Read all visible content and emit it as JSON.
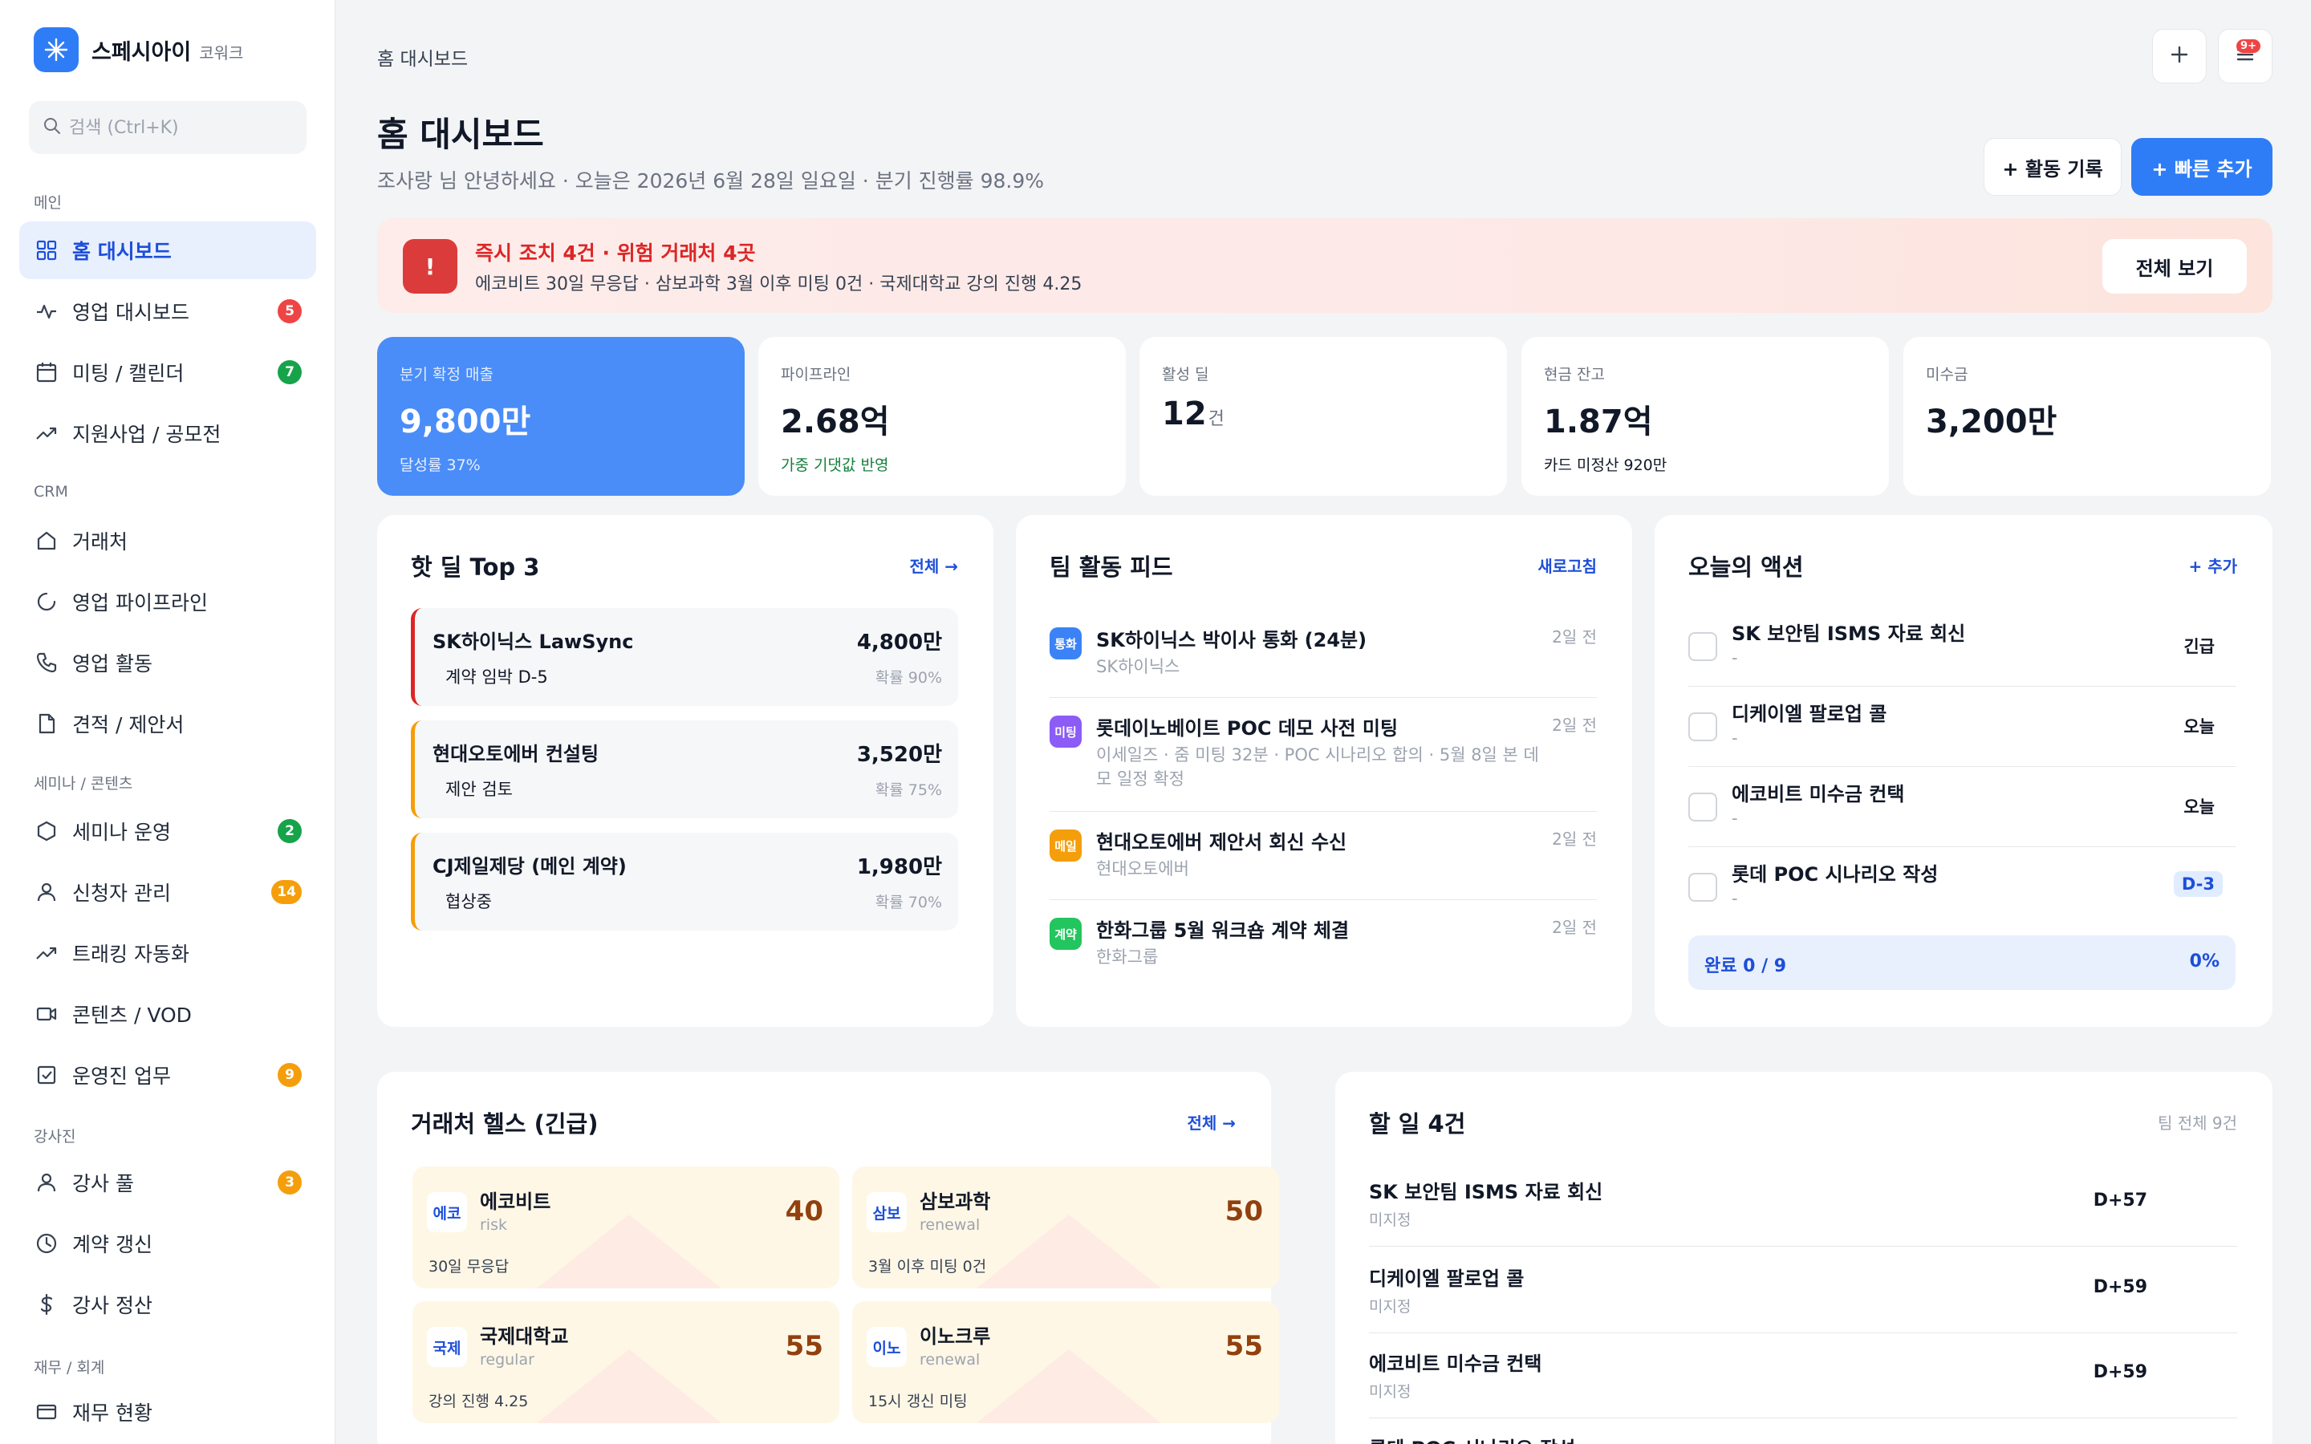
{
  "brand": {
    "name": "스페시아이",
    "sub": "코워크"
  },
  "search": {
    "placeholder": "검색 (Ctrl+K)"
  },
  "sidebar": {
    "sections": [
      "메인",
      "CRM",
      "세미나 / 콘텐츠",
      "강사진",
      "재무 / 회계"
    ],
    "items": [
      {
        "label": "홈 대시보드",
        "icon": "grid-icon",
        "active": true
      },
      {
        "label": "영업 대시보드",
        "icon": "activity-icon",
        "badge": "5",
        "badge_color": "#ef4444"
      },
      {
        "label": "미팅 / 캘린더",
        "icon": "calendar-icon",
        "badge": "7",
        "badge_color": "#16a34a"
      },
      {
        "label": "지원사업 / 공모전",
        "icon": "trending-up-icon"
      },
      {
        "label": "거래처",
        "icon": "home-icon"
      },
      {
        "label": "영업 파이프라인",
        "icon": "loader-icon"
      },
      {
        "label": "영업 활동",
        "icon": "phone-icon"
      },
      {
        "label": "견적 / 제안서",
        "icon": "file-icon"
      },
      {
        "label": "세미나 운영",
        "icon": "hexagon-icon",
        "badge": "2",
        "badge_color": "#16a34a"
      },
      {
        "label": "신청자 관리",
        "icon": "user-icon",
        "badge": "14",
        "badge_color": "#f59e0b"
      },
      {
        "label": "트래킹 자동화",
        "icon": "trending-up-icon"
      },
      {
        "label": "콘텐츠 / VOD",
        "icon": "video-icon"
      },
      {
        "label": "운영진 업무",
        "icon": "check-square-icon",
        "badge": "9",
        "badge_color": "#f59e0b"
      },
      {
        "label": "강사 풀",
        "icon": "user-icon",
        "badge": "3",
        "badge_color": "#f59e0b"
      },
      {
        "label": "계약 갱신",
        "icon": "clock-icon"
      },
      {
        "label": "강사 정산",
        "icon": "dollar-icon"
      },
      {
        "label": "재무 현황",
        "icon": "credit-card-icon"
      }
    ]
  },
  "header": {
    "breadcrumb": "홈 대시보드",
    "title": "홈 대시보드",
    "subtitle": "조사랑 님 안녕하세요 · 오늘은 2026년 6월 28일 일요일 · 분기 진행률 98.9%",
    "notif_badge": "9+",
    "log_activity": "+ 활동 기록",
    "quick_add": "+ 빠른 추가"
  },
  "alert": {
    "icon_text": "!",
    "title": "즉시 조치 4건 · 위험 거래처 4곳",
    "desc": "에코비트 30일 무응답 · 삼보과학 3월 이후 미팅 0건 · 국제대학교 강의 진행 4.25",
    "button": "전체 보기"
  },
  "kpis": [
    {
      "label": "분기 확정 매출",
      "value": "9,800만",
      "foot": "달성률 37%"
    },
    {
      "label": "파이프라인",
      "value": "2.68억",
      "foot": "가중 기댓값 반영"
    },
    {
      "label": "활성 딜",
      "value": "12",
      "unit": "건",
      "foot": ""
    },
    {
      "label": "현금 잔고",
      "value": "1.87억",
      "foot": "카드 미정산 920만"
    },
    {
      "label": "미수금",
      "value": "3,200만",
      "foot": ""
    }
  ],
  "hot_deals": {
    "title": "핫 딜 Top 3",
    "link": "전체 →",
    "items": [
      {
        "name": "SK하이닉스 LawSync",
        "stage": "계약 임박 D-5",
        "amount": "4,800만",
        "prob": "확률 90%",
        "color": "#dc2626"
      },
      {
        "name": "현대오토에버 컨설팅",
        "stage": "제안 검토",
        "amount": "3,520만",
        "prob": "확률 75%",
        "color": "#f59e0b"
      },
      {
        "name": "CJ제일제당 (메인 계약)",
        "stage": "협상중",
        "amount": "1,980만",
        "prob": "확률 70%",
        "color": "#f59e0b"
      }
    ]
  },
  "team_feed": {
    "title": "팀 활동 피드",
    "link": "새로고침",
    "items": [
      {
        "tag": "통화",
        "tag_color": "#3b82f6",
        "title": "SK하이닉스 박이사 통화 (24분)",
        "sub": "SK하이닉스",
        "time": "2일 전"
      },
      {
        "tag": "미팅",
        "tag_color": "#8b5cf6",
        "title": "롯데이노베이트 POC 데모 사전 미팅",
        "sub": "이세일즈 · 줌 미팅 32분 · POC 시나리오 합의 · 5월 8일 본 데모 일정 확정",
        "time": "2일 전"
      },
      {
        "tag": "메일",
        "tag_color": "#f59e0b",
        "title": "현대오토에버 제안서 회신 수신",
        "sub": "현대오토에버",
        "time": "2일 전"
      },
      {
        "tag": "계약",
        "tag_color": "#22c55e",
        "title": "한화그룹 5월 워크숍 계약 체결",
        "sub": "한화그룹",
        "time": "2일 전"
      }
    ]
  },
  "today_actions": {
    "title": "오늘의 액션",
    "link": "+ 추가",
    "items": [
      {
        "title": "SK 보안팀 ISMS 자료 회신",
        "sub": "-",
        "tag": "긴급"
      },
      {
        "title": "디케이엘 팔로업 콜",
        "sub": "-",
        "tag": "오늘"
      },
      {
        "title": "에코비트 미수금 컨택",
        "sub": "-",
        "tag": "오늘"
      },
      {
        "title": "롯데 POC 시나리오 작성",
        "sub": "-",
        "tag": "D-3",
        "highlight": true
      }
    ],
    "progress_label": "완료 0 / 9",
    "progress_pct": "0%",
    "progress_value": 0
  },
  "client_health": {
    "title": "거래처 헬스 (긴급)",
    "link": "전체 →",
    "items": [
      {
        "abbr": "에코",
        "name": "에코비트",
        "type": "risk",
        "score": "40",
        "note": "30일 무응답"
      },
      {
        "abbr": "삼보",
        "name": "삼보과학",
        "type": "renewal",
        "score": "50",
        "note": "3월 이후 미팅 0건"
      },
      {
        "abbr": "국제",
        "name": "국제대학교",
        "type": "regular",
        "score": "55",
        "note": "강의 진행 4.25"
      },
      {
        "abbr": "이노",
        "name": "이노크루",
        "type": "renewal",
        "score": "55",
        "note": "15시 갱신 미팅"
      }
    ]
  },
  "todos": {
    "title": "할 일 4건",
    "meta": "팀 전체 9건",
    "items": [
      {
        "title": "SK 보안팀 ISMS 자료 회신",
        "sub": "미지정",
        "due": "D+57"
      },
      {
        "title": "디케이엘 팔로업 콜",
        "sub": "미지정",
        "due": "D+59"
      },
      {
        "title": "에코비트 미수금 컨택",
        "sub": "미지정",
        "due": "D+59"
      },
      {
        "title": "롯데 POC 시나리오 작성",
        "sub": "",
        "due": ""
      }
    ]
  }
}
